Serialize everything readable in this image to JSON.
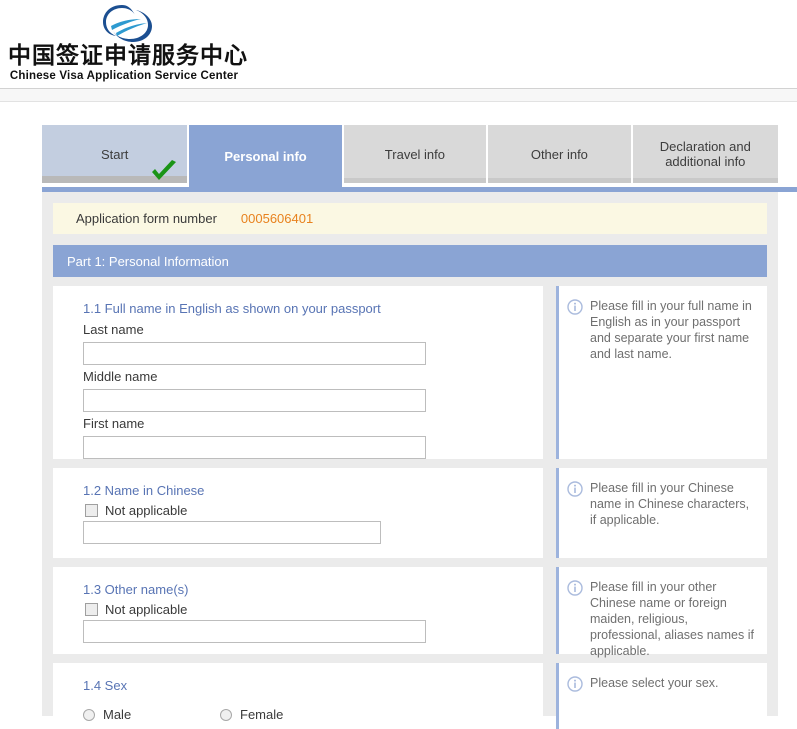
{
  "brand": {
    "logo_icon": "globe-swoosh-logo",
    "name_cn": "中国签证申请服务中心",
    "name_en": "Chinese Visa Application Service Center"
  },
  "tabs": [
    {
      "label": "Start",
      "state": "completed",
      "icon": "green-check-icon"
    },
    {
      "label": "Personal info",
      "state": "active"
    },
    {
      "label": "Travel info",
      "state": "inactive"
    },
    {
      "label": "Other info",
      "state": "inactive"
    },
    {
      "label": "Declaration and additional info",
      "state": "inactive"
    }
  ],
  "form": {
    "app_number_label": "Application form number",
    "app_number_value": "0005606401",
    "app_number_color": "#e8821e",
    "part_header": "Part 1: Personal Information",
    "part_header_color": "#8aa4d4"
  },
  "questions": [
    {
      "id": "1.1",
      "title": "1.1 Full name in English as shown on your passport",
      "fields": [
        {
          "label": "Last name",
          "value": "",
          "placeholder": ""
        },
        {
          "label": "Middle name",
          "value": "",
          "placeholder": ""
        },
        {
          "label": "First name",
          "value": "",
          "placeholder": ""
        }
      ],
      "help": "Please fill in your full name in English as in your passport and separate your first name and last name."
    },
    {
      "id": "1.2",
      "title": "1.2 Name in Chinese",
      "not_applicable_label": "Not applicable",
      "not_applicable_checked": false,
      "value": "",
      "help": "Please fill in your Chinese name in Chinese characters, if applicable."
    },
    {
      "id": "1.3",
      "title": "1.3 Other name(s)",
      "not_applicable_label": "Not applicable",
      "not_applicable_checked": false,
      "value": "",
      "help": "Please fill in your other Chinese name or foreign maiden, religious, professional, aliases names if applicable."
    },
    {
      "id": "1.4",
      "title": "1.4 Sex",
      "options": [
        {
          "label": "Male",
          "selected": false
        },
        {
          "label": "Female",
          "selected": false
        }
      ],
      "help": "Please select your sex."
    }
  ],
  "icons": {
    "info": "info-circle-icon",
    "check": "green-check-icon"
  }
}
